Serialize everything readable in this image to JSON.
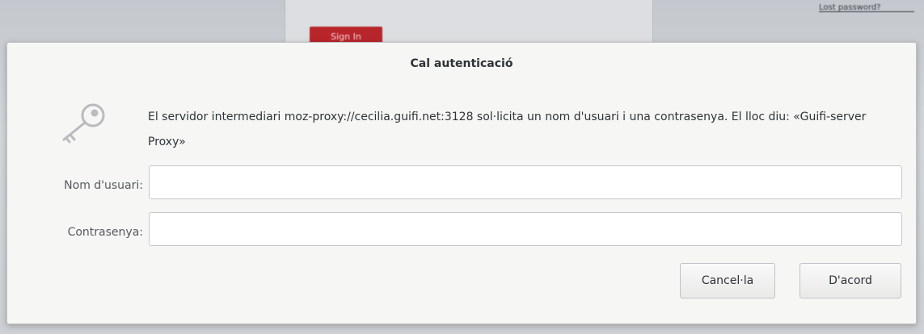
{
  "background": {
    "link_text": "Lost password?",
    "button_label": "Sign In"
  },
  "dialog": {
    "title": "Cal autenticació",
    "message": "El servidor intermediari moz-proxy://cecilia.guifi.net:3128 sol·licita un nom d'usuari i una contrasenya. El lloc diu: «Guifi-server Proxy»",
    "icon": "key-icon",
    "username_label": "Nom d'usuari:",
    "username_value": "",
    "password_label": "Contrasenya:",
    "password_value": "",
    "cancel_label": "Cancel·la",
    "ok_label": "D'acord"
  },
  "colors": {
    "background_button": "#b8262c",
    "dialog_bg": "#f6f6f5",
    "text": "#2e3436"
  }
}
